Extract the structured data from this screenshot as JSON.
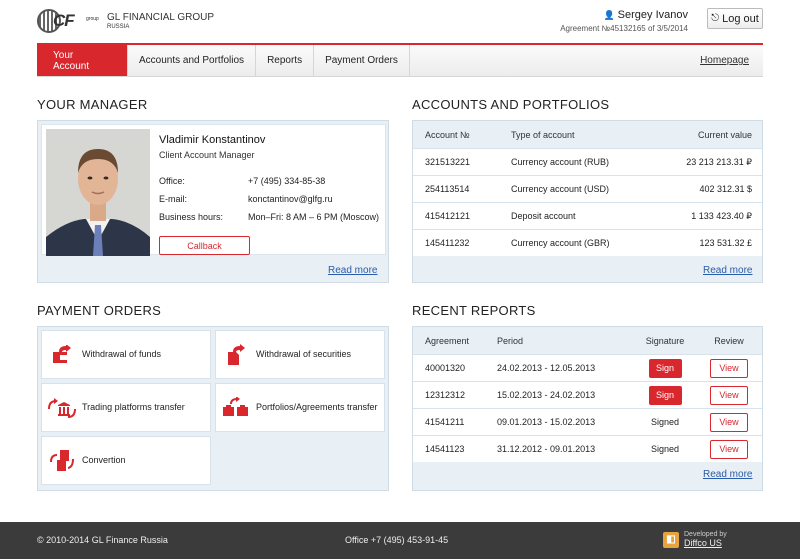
{
  "header": {
    "logo_mark": "CF",
    "logo_group": "group",
    "company_name": "GL FINANCIAL GROUP",
    "company_region": "RUSSIA",
    "user_name": "Sergey Ivanov",
    "agreement": "Agreement №45132165 of 3/5/2014",
    "logout_label": "Log out"
  },
  "nav": {
    "tabs": [
      {
        "label": "Your Account"
      },
      {
        "label": "Accounts and Portfolios"
      },
      {
        "label": "Reports"
      },
      {
        "label": "Payment Orders"
      }
    ],
    "homepage": "Homepage"
  },
  "manager": {
    "section_title": "YOUR MANAGER",
    "name": "Vladimir Konstantinov",
    "role": "Client Account Manager",
    "rows": [
      {
        "key": "Office:",
        "value": "+7 (495) 334-85-38"
      },
      {
        "key": "E-mail:",
        "value": "konctantinov@glfg.ru"
      },
      {
        "key": "Business hours:",
        "value": "Mon–Fri: 8 AM – 6 PM (Moscow)"
      }
    ],
    "callback_label": "Callback",
    "read_more": "Read more"
  },
  "accounts": {
    "section_title": "ACCOUNTS AND PORTFOLIOS",
    "columns": [
      "Account №",
      "Type of account",
      "Current value"
    ],
    "rows": [
      {
        "number": "321513221",
        "type": "Currency account (RUB)",
        "value": "23 213 213.31 ₽"
      },
      {
        "number": "254113514",
        "type": "Currency account (USD)",
        "value": "402 312.31 $"
      },
      {
        "number": "415412121",
        "type": "Deposit account",
        "value": "1 133 423.40 ₽"
      },
      {
        "number": "145411232",
        "type": "Currency account (GBR)",
        "value": "123 531.32 £"
      }
    ],
    "read_more": "Read more"
  },
  "payment_orders": {
    "section_title": "PAYMENT ORDERS",
    "items": [
      {
        "label": "Withdrawal of funds",
        "icon": "withdraw-funds-icon"
      },
      {
        "label": "Withdrawal of securities",
        "icon": "withdraw-securities-icon"
      },
      {
        "label": "Trading platforms transfer",
        "icon": "platform-transfer-icon"
      },
      {
        "label": "Portfolios/Agreements transfer",
        "icon": "portfolio-transfer-icon"
      },
      {
        "label": "Convertion",
        "icon": "conversion-icon"
      }
    ]
  },
  "reports": {
    "section_title": "RECENT REPORTS",
    "columns": [
      "Agreement",
      "Period",
      "Signature",
      "Review"
    ],
    "rows": [
      {
        "agreement": "40001320",
        "period": "24.02.2013 - 12.05.2013",
        "signature": "Sign",
        "signed": false,
        "review": "View"
      },
      {
        "agreement": "12312312",
        "period": "15.02.2013 - 24.02.2013",
        "signature": "Sign",
        "signed": false,
        "review": "View"
      },
      {
        "agreement": "41541211",
        "period": "09.01.2013 - 15.02.2013",
        "signature": "Signed",
        "signed": true,
        "review": "View"
      },
      {
        "agreement": "14541123",
        "period": "31.12.2012 - 09.01.2013",
        "signature": "Signed",
        "signed": true,
        "review": "View"
      }
    ],
    "read_more": "Read more"
  },
  "footer": {
    "copyright_prefix": "© 2010-2014",
    "copyright_link": "GL Finance Russia",
    "office": "Office +7 (495) 453-91-45",
    "developed_by": "Developed by",
    "developer": "Diffco US"
  },
  "colors": {
    "accent": "#d9272e",
    "panel": "#e8eff5",
    "footer": "#3b3b3b"
  }
}
